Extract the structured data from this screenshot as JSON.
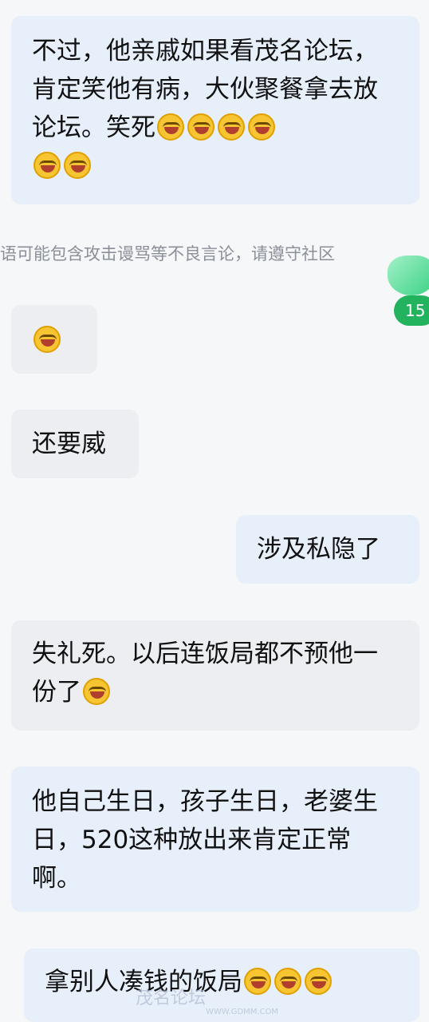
{
  "messages": [
    {
      "text": "不过，他亲戚如果看茂名论坛，肯定笑他有病，大伙聚餐拿去放论坛。笑死"
    },
    {
      "text": ""
    },
    {
      "text": "还要威"
    },
    {
      "text": "涉及私隐了"
    },
    {
      "text": "失礼死。以后连饭局都不预他一份了"
    },
    {
      "text": "他自己生日，孩子生日，老婆生日，520这种放出来肯定正常啊。"
    },
    {
      "text": "拿别人凑钱的饭局"
    }
  ],
  "warning_text": "语可能包含攻击谩骂等不良言论，请遵守社区",
  "floating_badge": "15",
  "watermark": {
    "main": "茂名论坛",
    "sub": "WWW.GDMM.COM"
  },
  "colors": {
    "bubble_blue": "#e6effa",
    "bubble_gray": "#eceef1",
    "badge_green": "#23b35e"
  }
}
